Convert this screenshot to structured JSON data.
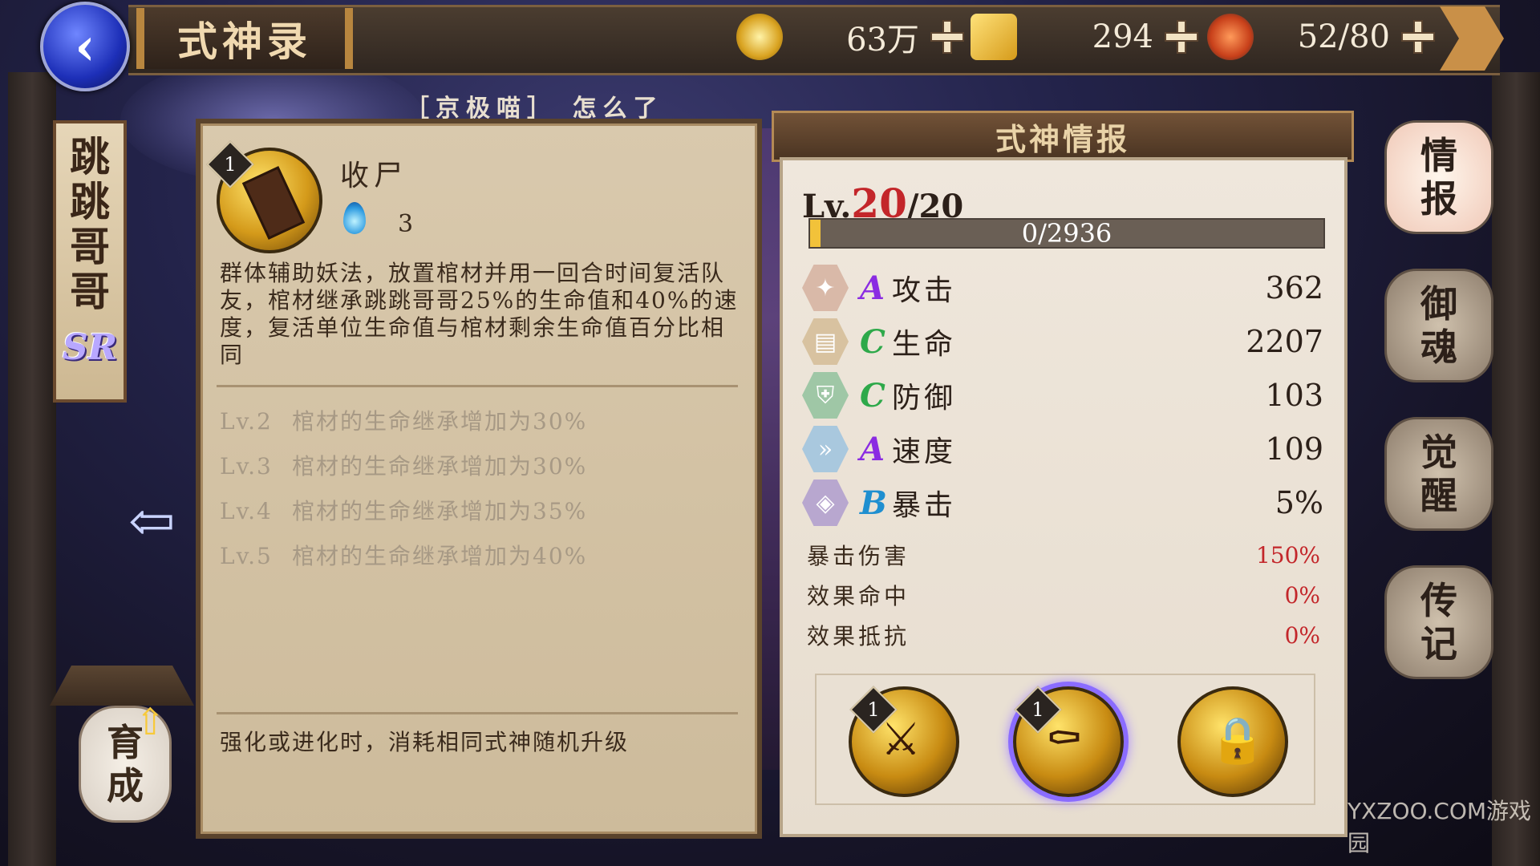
{
  "header": {
    "back_icon": "back-arrow-icon",
    "title": "式神录",
    "resources": [
      {
        "icon": "coin-icon",
        "value": "63万"
      },
      {
        "icon": "gold-ingot-icon",
        "value": "294"
      },
      {
        "icon": "sushi-stamina-icon",
        "value": "52/80"
      }
    ]
  },
  "shikigami": {
    "name_chars": [
      "跳",
      "跳",
      "哥",
      "哥"
    ],
    "rarity": "SR"
  },
  "marquee": "［京极喵］ 怎么了",
  "skill": {
    "number": "1",
    "name": "收尸",
    "cost": "3",
    "description": "群体辅助妖法，放置棺材并用一回合时间复活队友，棺材继承跳跳哥哥25%的生命值和40%的速度，复活单位生命值与棺材剩余生命值百分比相同",
    "upgrades": [
      {
        "level": "Lv.2",
        "text": "棺材的生命继承增加为30%"
      },
      {
        "level": "Lv.3",
        "text": "棺材的生命继承增加为30%"
      },
      {
        "level": "Lv.4",
        "text": "棺材的生命继承增加为35%"
      },
      {
        "level": "Lv.5",
        "text": "棺材的生命继承增加为40%"
      }
    ],
    "footer": "强化或进化时，消耗相同式神随机升级"
  },
  "info": {
    "title": "式神情报",
    "level_prefix": "Lv.",
    "level_current": "20",
    "level_max": "/20",
    "exp_text": "0/2936",
    "exp_fraction": 0.02,
    "stats": [
      {
        "icon": "fan-attack-icon",
        "grade": "A",
        "grade_color": "#8a2be2",
        "label": "攻击",
        "value": "362"
      },
      {
        "icon": "scroll-health-icon",
        "grade": "C",
        "grade_color": "#2ea94a",
        "label": "生命",
        "value": "2207"
      },
      {
        "icon": "armor-defense-icon",
        "grade": "C",
        "grade_color": "#2ea94a",
        "label": "防御",
        "value": "103"
      },
      {
        "icon": "chevron-speed-icon",
        "grade": "A",
        "grade_color": "#8a2be2",
        "label": "速度",
        "value": "109"
      },
      {
        "icon": "talisman-crit-icon",
        "grade": "B",
        "grade_color": "#1f8fd0",
        "label": "暴击",
        "value": "5%"
      }
    ],
    "sub_stats": [
      {
        "label": "暴击伤害",
        "value": "150%"
      },
      {
        "label": "效果命中",
        "value": "0%"
      },
      {
        "label": "效果抵抗",
        "value": "0%"
      }
    ],
    "skill_slots": [
      {
        "icon": "skill-attack-icon",
        "badge": "1",
        "selected": false
      },
      {
        "icon": "skill-coffin-icon",
        "badge": "1",
        "selected": true
      },
      {
        "icon": "skill-locked-icon",
        "badge": "",
        "selected": false
      }
    ]
  },
  "tabs": [
    {
      "line1": "情",
      "line2": "报",
      "active": true
    },
    {
      "line1": "御",
      "line2": "魂",
      "active": false
    },
    {
      "line1": "觉",
      "line2": "醒",
      "active": false
    },
    {
      "line1": "传",
      "line2": "记",
      "active": false
    }
  ],
  "nurture": {
    "line1": "育",
    "line2": "成"
  },
  "watermark": "YXZOO.COM游戏园"
}
